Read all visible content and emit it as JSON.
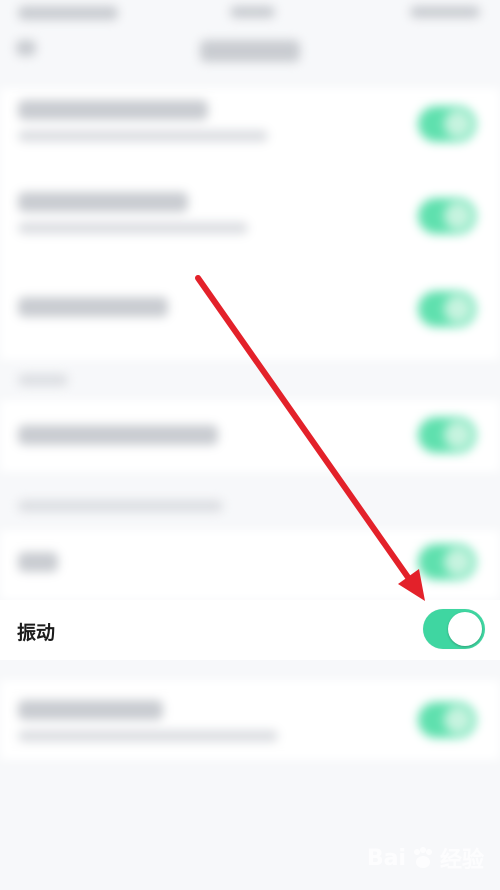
{
  "setting": {
    "label": "振动",
    "enabled": true
  },
  "watermark": {
    "brand": "Bai",
    "suffix": "经验"
  },
  "colors": {
    "toggle_on": "#3fd6a1",
    "arrow": "#e3212a"
  }
}
